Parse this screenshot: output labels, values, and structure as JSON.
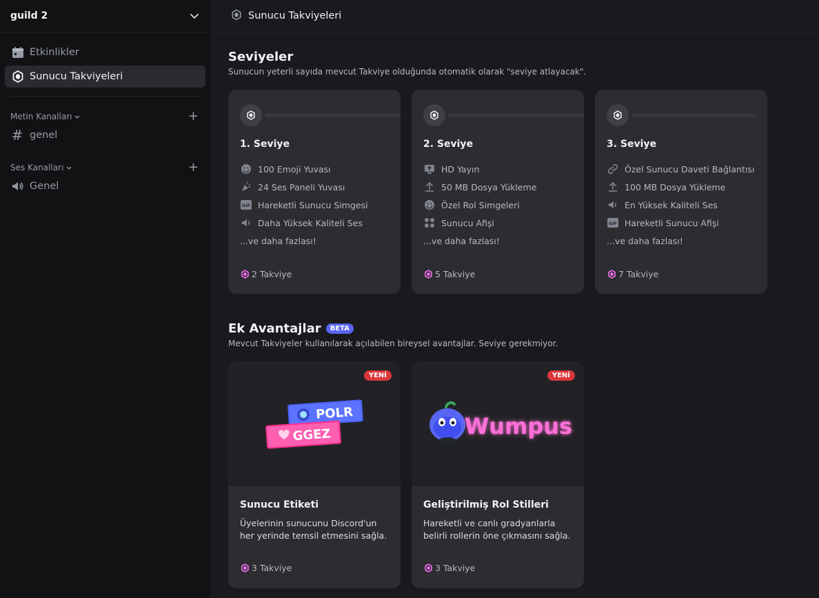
{
  "sidebar": {
    "guild_name": "guild 2",
    "nav": [
      {
        "label": "Etkinlikler",
        "icon": "calendar-icon"
      },
      {
        "label": "Sunucu Takviyeleri",
        "icon": "boost-icon"
      }
    ],
    "text_category": "Metin Kanalları",
    "text_channels": [
      {
        "label": "genel",
        "icon": "hash-icon"
      }
    ],
    "voice_category": "Ses Kanalları",
    "voice_channels": [
      {
        "label": "Genel",
        "icon": "speaker-icon"
      }
    ]
  },
  "topbar": {
    "title": "Sunucu Takviyeleri"
  },
  "levels": {
    "heading": "Seviyeler",
    "subtitle": "Sunucun yeterli sayıda mevcut Takviye olduğunda otomatik olarak \"seviye atlayacak\".",
    "tiers": [
      {
        "title": "1. Seviye",
        "perks": [
          {
            "label": "100 Emoji Yuvası",
            "icon": "emoji-icon"
          },
          {
            "label": "24 Ses Paneli Yuvası",
            "icon": "soundboard-icon"
          },
          {
            "label": "Hareketli Sunucu Simgesi",
            "icon": "gif-icon"
          },
          {
            "label": "Daha Yüksek Kaliteli Ses",
            "icon": "speaker-icon"
          }
        ],
        "more": "...ve daha fazlası!",
        "cost": "2 Takviye"
      },
      {
        "title": "2. Seviye",
        "perks": [
          {
            "label": "HD Yayın",
            "icon": "screen-share-icon"
          },
          {
            "label": "50 MB Dosya Yükleme",
            "icon": "upload-icon"
          },
          {
            "label": "Özel Rol Simgeleri",
            "icon": "emoji-icon"
          },
          {
            "label": "Sunucu Afişi",
            "icon": "grid-icon"
          }
        ],
        "more": "...ve daha fazlası!",
        "cost": "5 Takviye"
      },
      {
        "title": "3. Seviye",
        "perks": [
          {
            "label": "Özel Sunucu Daveti Bağlantısı",
            "icon": "link-icon"
          },
          {
            "label": "100 MB Dosya Yükleme",
            "icon": "upload-icon"
          },
          {
            "label": "En Yüksek Kaliteli Ses",
            "icon": "speaker-icon"
          },
          {
            "label": "Hareketli Sunucu Afişi",
            "icon": "gif-icon"
          }
        ],
        "more": "...ve daha fazlası!",
        "cost": "7 Takviye"
      }
    ]
  },
  "extra": {
    "heading": "Ek Avantajlar",
    "beta": "BETA",
    "subtitle": "Mevcut Takviyeler kullanılarak açılabilen bireysel avantajlar. Seviye gerekmiyor.",
    "cards": [
      {
        "badge": "YENİ",
        "title": "Sunucu Etiketi",
        "desc": "Üyelerinin sunucunu Discord'un her yerinde temsil etmesini sağla.",
        "cost": "3 Takviye",
        "art_tags": [
          "POLR",
          "GGEZ"
        ]
      },
      {
        "badge": "YENİ",
        "title": "Geliştirilmiş Rol Stilleri",
        "desc": "Hareketli ve canlı gradyanlarla belirli rollerin öne çıkmasını sağla.",
        "cost": "3 Takviye",
        "art_text": "Wumpus"
      }
    ]
  },
  "colors": {
    "accent": "#5865f2",
    "boost_pink": "#ff73fa",
    "new_red": "#da373c",
    "card": "#2c2c31"
  }
}
